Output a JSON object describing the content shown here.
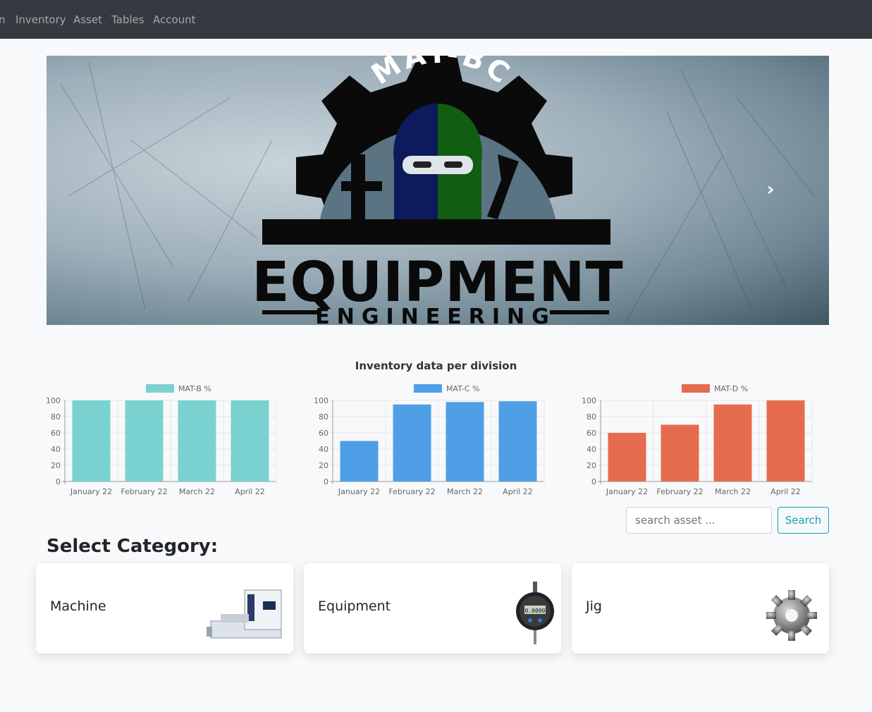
{
  "navbar": {
    "items": [
      {
        "label": "n"
      },
      {
        "label": "Inventory"
      },
      {
        "label": "Asset"
      },
      {
        "label": "Tables"
      },
      {
        "label": "Account"
      }
    ]
  },
  "banner": {
    "logo_top_text": "MAT-BC",
    "logo_main_text": "EQUIPMENT",
    "logo_sub_text": "ENGINEERING",
    "next_icon": "chevron-right-icon"
  },
  "charts": {
    "title": "Inventory data per division"
  },
  "chart_data": [
    {
      "type": "bar",
      "categories": [
        "January 22",
        "February 22",
        "March 22",
        "April 22"
      ],
      "series": [
        {
          "name": "MAT-B %",
          "values": [
            100,
            100,
            100,
            100
          ]
        }
      ],
      "ylim": [
        0,
        100
      ],
      "yticks": [
        0,
        20,
        40,
        60,
        80,
        100
      ],
      "color": "#79d2cf",
      "legend": "top"
    },
    {
      "type": "bar",
      "categories": [
        "January 22",
        "February 22",
        "March 22",
        "April 22"
      ],
      "series": [
        {
          "name": "MAT-C %",
          "values": [
            50,
            95,
            98,
            99
          ]
        }
      ],
      "ylim": [
        0,
        100
      ],
      "yticks": [
        0,
        20,
        40,
        60,
        80,
        100
      ],
      "color": "#4f9fe6",
      "legend": "top"
    },
    {
      "type": "bar",
      "categories": [
        "January 22",
        "February 22",
        "March 22",
        "April 22"
      ],
      "series": [
        {
          "name": "MAT-D %",
          "values": [
            60,
            70,
            95,
            100
          ]
        }
      ],
      "ylim": [
        0,
        100
      ],
      "yticks": [
        0,
        20,
        40,
        60,
        80,
        100
      ],
      "color": "#e66c4f",
      "legend": "top"
    }
  ],
  "search": {
    "placeholder": "search asset ...",
    "button_label": "Search"
  },
  "categories": {
    "heading": "Select Category:",
    "items": [
      {
        "label": "Machine",
        "icon": "cmm-machine-icon"
      },
      {
        "label": "Equipment",
        "icon": "dial-indicator-icon"
      },
      {
        "label": "Jig",
        "icon": "gear-icon"
      }
    ]
  }
}
